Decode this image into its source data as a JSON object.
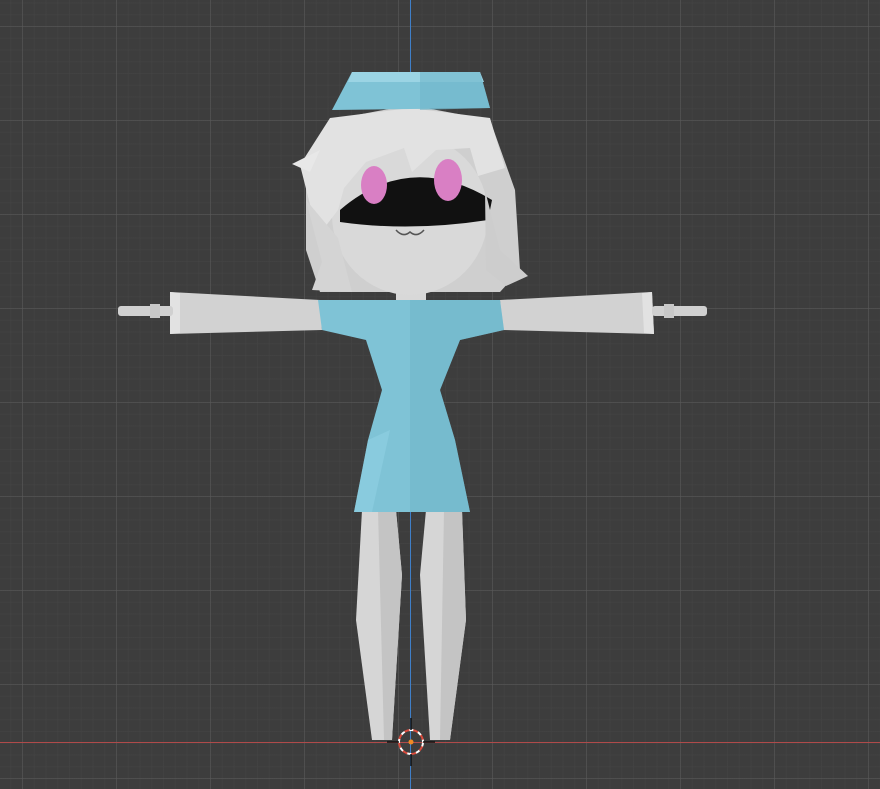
{
  "viewport": {
    "mode": "3d-viewport",
    "background_color": "#3d3d3d",
    "grid_color": "#5a5a5a",
    "x_axis_color": "#b04a4a",
    "y_axis_color": "#3f7fc8"
  },
  "model": {
    "pose": "T-pose",
    "colors": {
      "outfit": "#7fc3d6",
      "body": "#d9d9d9",
      "visor": "#101010",
      "eyes": "#d97fc4"
    }
  },
  "cursor": {
    "icon": "3d-cursor-icon"
  }
}
